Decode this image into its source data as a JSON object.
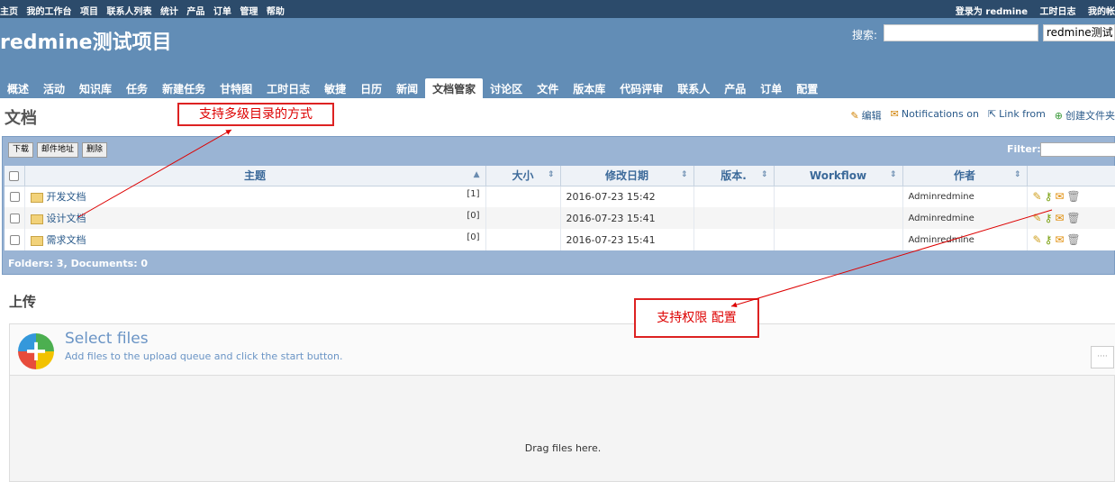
{
  "topbar": {
    "left": [
      "主页",
      "我的工作台",
      "项目",
      "联系人列表",
      "统计",
      "产品",
      "订单",
      "管理",
      "帮助"
    ],
    "right": [
      "登录为 redmine",
      "工时日志",
      "我的帐"
    ]
  },
  "header": {
    "project_title": "redmine测试项目",
    "search_label": "搜索:",
    "search_value": "",
    "project_select": "redmine测试"
  },
  "tabs": [
    "概述",
    "活动",
    "知识库",
    "任务",
    "新建任务",
    "甘特图",
    "工时日志",
    "敏捷",
    "日历",
    "新闻",
    "文档管家",
    "讨论区",
    "文件",
    "版本库",
    "代码评审",
    "联系人",
    "产品",
    "订单",
    "配置"
  ],
  "active_tab": "文档管家",
  "page": {
    "title": "文档",
    "actions": {
      "edit": "编辑",
      "notifications": "Notifications on",
      "link": "Link from",
      "create": "创建文件夹"
    }
  },
  "callouts": {
    "first": "支持多级目录的方式",
    "second": "支持权限 配置"
  },
  "toolbar": {
    "download": "下载",
    "mail": "邮件地址",
    "delete": "删除",
    "filter_label": "Filter:"
  },
  "table": {
    "headers": [
      "主题",
      "大小",
      "修改日期",
      "版本.",
      "Workflow",
      "作者"
    ],
    "rows": [
      {
        "name": "开发文档",
        "count": "[1]",
        "size": "",
        "date": "2016-07-23 15:42",
        "version": "",
        "workflow": "",
        "author": "Adminredmine"
      },
      {
        "name": "设计文档",
        "count": "[0]",
        "size": "",
        "date": "2016-07-23 15:41",
        "version": "",
        "workflow": "",
        "author": "Adminredmine"
      },
      {
        "name": "需求文档",
        "count": "[0]",
        "size": "",
        "date": "2016-07-23 15:41",
        "version": "",
        "workflow": "",
        "author": "Adminredmine"
      }
    ],
    "footer": "Folders: 3, Documents: 0"
  },
  "upload": {
    "title": "上传",
    "select_title": "Select files",
    "select_sub": "Add files to the upload queue and click the start button.",
    "drag": "Drag files here."
  },
  "icons": [
    "pencil-icon",
    "key-icon",
    "mail-icon",
    "trash-icon",
    "folder-icon",
    "plus-icon",
    "external-link-icon"
  ]
}
